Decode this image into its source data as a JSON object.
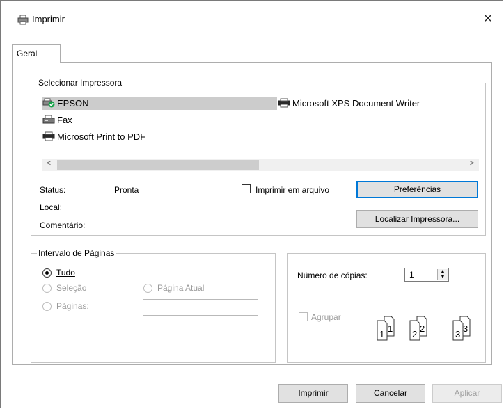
{
  "window": {
    "title": "Imprimir",
    "close_glyph": "×"
  },
  "tabs": [
    {
      "label": "Geral"
    }
  ],
  "select_printer": {
    "group_title": "Selecionar Impressora",
    "printers": [
      {
        "name": "EPSON",
        "icon": "default-printer-icon",
        "selected": true
      },
      {
        "name": "Fax",
        "icon": "fax-icon",
        "selected": false
      },
      {
        "name": "Microsoft Print to PDF",
        "icon": "printer-icon",
        "selected": false
      },
      {
        "name": "Microsoft XPS Document Writer",
        "icon": "printer-icon",
        "selected": false
      }
    ],
    "scroll_left": "<",
    "scroll_right": ">",
    "status_label": "Status:",
    "status_value": "Pronta",
    "location_label": "Local:",
    "location_value": "",
    "comment_label": "Comentário:",
    "comment_value": "",
    "print_to_file_label": "Imprimir em arquivo",
    "preferences_button": "Preferências",
    "find_printer_button": "Localizar Impressora..."
  },
  "page_range": {
    "group_title": "Intervalo de Páginas",
    "all_label": "Tudo",
    "selection_label": "Seleção",
    "current_page_label": "Página Atual",
    "pages_label": "Páginas:",
    "pages_value": ""
  },
  "copies": {
    "label": "Número de cópias:",
    "value": "1",
    "collate_label": "Agrupar",
    "collate_numbers": [
      "1",
      "1",
      "2",
      "2",
      "3",
      "3"
    ]
  },
  "footer": {
    "print_button": "Imprimir",
    "cancel_button": "Cancelar",
    "apply_button": "Aplicar"
  },
  "colors": {
    "accent": "#0078d7",
    "selection": "#cccccc",
    "border": "#adadad"
  }
}
